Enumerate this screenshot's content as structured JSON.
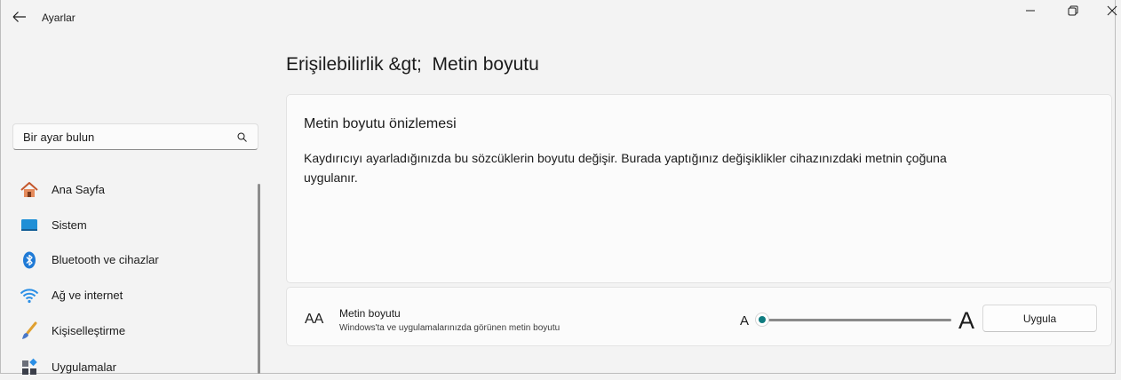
{
  "window": {
    "title": "Ayarlar",
    "back_icon": "back-arrow-icon",
    "controls": [
      "minimize-icon",
      "restore-icon",
      "close-icon"
    ]
  },
  "search": {
    "placeholder": "Bir ayar bulun",
    "icon": "search-icon"
  },
  "sidebar": {
    "items": [
      {
        "label": "Ana Sayfa",
        "icon": "home-icon"
      },
      {
        "label": "Sistem",
        "icon": "system-icon"
      },
      {
        "label": "Bluetooth ve cihazlar",
        "icon": "bluetooth-icon"
      },
      {
        "label": "Ağ ve internet",
        "icon": "wifi-icon"
      },
      {
        "label": "Kişiselleştirme",
        "icon": "brush-icon"
      },
      {
        "label": "Uygulamalar",
        "icon": "apps-icon"
      }
    ]
  },
  "page": {
    "breadcrumb_parent": "Erişilebilirlik &gt;",
    "breadcrumb_current": "Metin boyutu"
  },
  "preview": {
    "heading": "Metin boyutu önizlemesi",
    "body": "Kaydırıcıyı ayarladığınızda bu sözcüklerin boyutu değişir. Burada yaptığınız değişiklikler cihazınızdaki metnin çoğuna uygulanır."
  },
  "text_size": {
    "icon_text": "AA",
    "title": "Metin boyutu",
    "description": "Windows'ta ve uygulamalarınızda görünen metin boyutu",
    "min_label": "A",
    "max_label": "A",
    "slider_value_fraction": 0.0,
    "apply_label": "Uygula"
  },
  "colors": {
    "accent": "#0f7c80",
    "background": "#f3f3f3",
    "card": "#fbfbfb"
  }
}
